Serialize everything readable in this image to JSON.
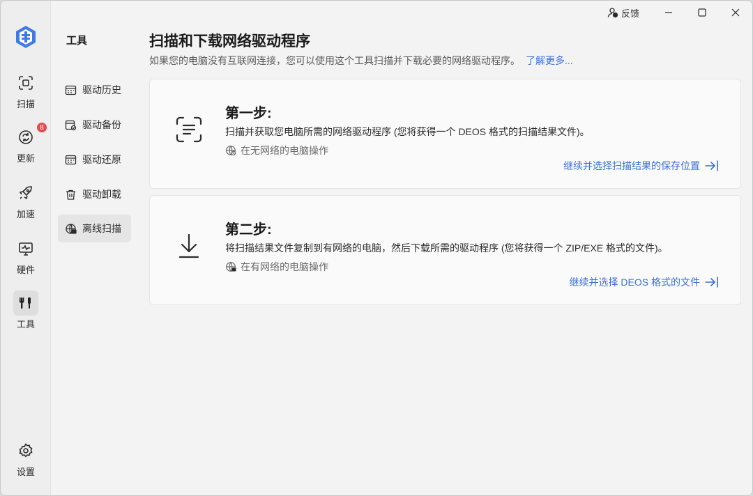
{
  "nav": {
    "items": [
      {
        "id": "scan",
        "label": "扫描",
        "icon": "scan-icon"
      },
      {
        "id": "update",
        "label": "更新",
        "icon": "refresh-icon",
        "badge": "8"
      },
      {
        "id": "boost",
        "label": "加速",
        "icon": "rocket-icon"
      },
      {
        "id": "hardware",
        "label": "硬件",
        "icon": "monitor-icon"
      },
      {
        "id": "tools",
        "label": "工具",
        "icon": "tools-icon",
        "active": true
      }
    ],
    "settings_label": "设置"
  },
  "submenu": {
    "title": "工具",
    "items": [
      {
        "label": "驱动历史",
        "icon": "history-icon"
      },
      {
        "label": "驱动备份",
        "icon": "backup-icon"
      },
      {
        "label": "驱动还原",
        "icon": "restore-icon"
      },
      {
        "label": "驱动卸载",
        "icon": "trash-icon"
      },
      {
        "label": "离线扫描",
        "icon": "offline-scan-icon",
        "active": true
      }
    ]
  },
  "titlebar": {
    "feedback_label": "反馈"
  },
  "page": {
    "title": "扫描和下载网络驱动程序",
    "description": "如果您的电脑没有互联网连接，您可以使用这个工具扫描并下载必要的网络驱动程序。",
    "learn_more": "了解更多..."
  },
  "steps": [
    {
      "title": "第一步:",
      "description": "扫描并获取您电脑所需的网络驱动程序 (您将获得一个 DEOS 格式的扫描结果文件)。",
      "note": "在无网络的电脑操作",
      "link": "继续并选择扫描结果的保存位置"
    },
    {
      "title": "第二步:",
      "description": "将扫描结果文件复制到有网络的电脑，然后下载所需的驱动程序 (您将获得一个 ZIP/EXE 格式的文件)。",
      "note": "在有网络的电脑操作",
      "link": "继续并选择 DEOS 格式的文件"
    }
  ],
  "colors": {
    "accent": "#3b6fd9",
    "badge": "#e5484d",
    "logo": "#3f7be8"
  }
}
